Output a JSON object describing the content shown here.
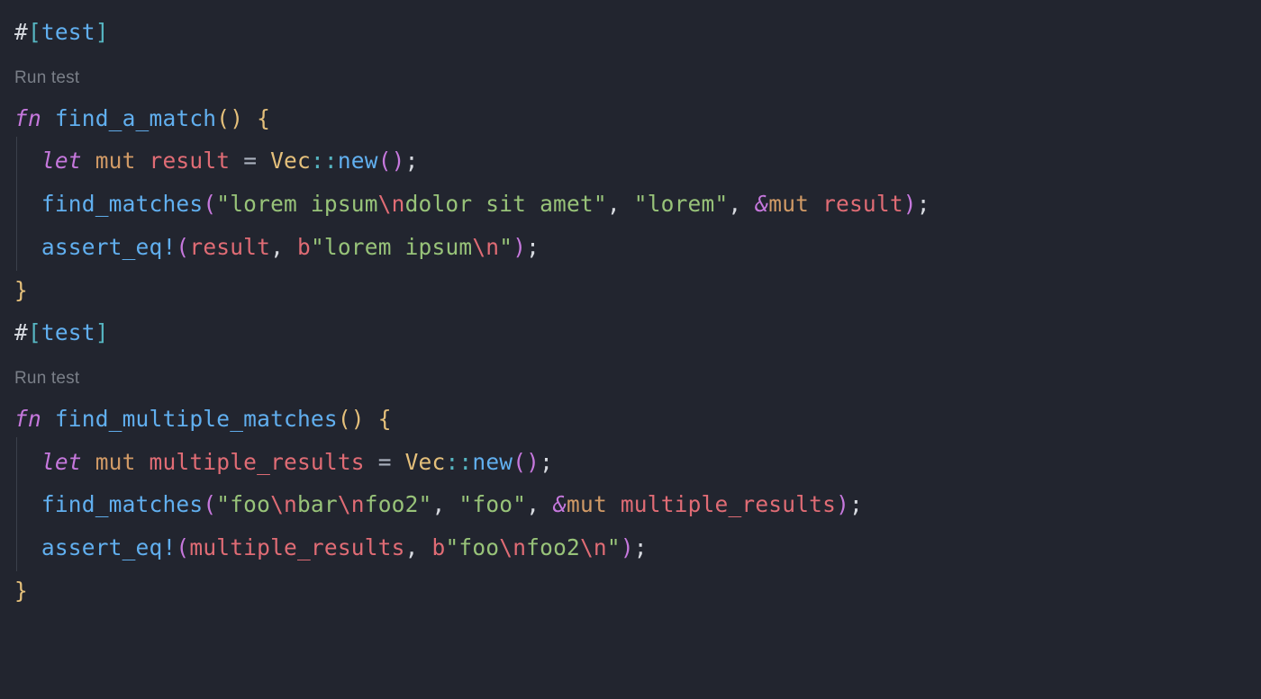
{
  "colors": {
    "bg": "#22252f",
    "fg": "#d7dae0",
    "muted": "#7a7f88",
    "keyword": "#c678dd",
    "orange": "#d19a66",
    "yellow": "#e5c07b",
    "blue": "#61afef",
    "green": "#98c379",
    "red": "#e06c75",
    "cyan": "#56b6c2"
  },
  "code": {
    "lines": [
      {
        "type": "attr",
        "tokens": [
          {
            "t": "#",
            "c": "punct"
          },
          {
            "t": "[",
            "c": "cyan"
          },
          {
            "t": "test",
            "c": "fn-call"
          },
          {
            "t": "]",
            "c": "cyan"
          }
        ]
      },
      {
        "type": "codelens",
        "text": "Run test"
      },
      {
        "type": "line",
        "indent": 0,
        "tokens": [
          {
            "t": "fn",
            "c": "kw-fn"
          },
          {
            "t": " ",
            "c": ""
          },
          {
            "t": "find_a_match",
            "c": "fn-name"
          },
          {
            "t": "()",
            "c": "by"
          },
          {
            "t": " ",
            "c": ""
          },
          {
            "t": "{",
            "c": "by"
          }
        ]
      },
      {
        "type": "line",
        "indent": 1,
        "tokens": [
          {
            "t": "let",
            "c": "kw-it"
          },
          {
            "t": " ",
            "c": ""
          },
          {
            "t": "mut",
            "c": "kw-mut"
          },
          {
            "t": " ",
            "c": ""
          },
          {
            "t": "result",
            "c": "var"
          },
          {
            "t": " ",
            "c": ""
          },
          {
            "t": "=",
            "c": "op"
          },
          {
            "t": " ",
            "c": ""
          },
          {
            "t": "Vec",
            "c": "type"
          },
          {
            "t": "::",
            "c": "cyan"
          },
          {
            "t": "new",
            "c": "fn-call"
          },
          {
            "t": "()",
            "c": "bc"
          },
          {
            "t": ";",
            "c": "punct"
          }
        ]
      },
      {
        "type": "line",
        "indent": 1,
        "tokens": [
          {
            "t": "find_matches",
            "c": "fn-call"
          },
          {
            "t": "(",
            "c": "bc"
          },
          {
            "t": "\"lorem ipsum",
            "c": "str"
          },
          {
            "t": "\\n",
            "c": "esc"
          },
          {
            "t": "dolor sit amet\"",
            "c": "str"
          },
          {
            "t": ",",
            "c": "punct"
          },
          {
            "t": " ",
            "c": ""
          },
          {
            "t": "\"lorem\"",
            "c": "str"
          },
          {
            "t": ",",
            "c": "punct"
          },
          {
            "t": " ",
            "c": ""
          },
          {
            "t": "&",
            "c": "kw-it"
          },
          {
            "t": "mut",
            "c": "kw-mut"
          },
          {
            "t": " ",
            "c": ""
          },
          {
            "t": "result",
            "c": "var"
          },
          {
            "t": ")",
            "c": "bc"
          },
          {
            "t": ";",
            "c": "punct"
          }
        ]
      },
      {
        "type": "line",
        "indent": 1,
        "tokens": [
          {
            "t": "assert_eq!",
            "c": "fn-call"
          },
          {
            "t": "(",
            "c": "bc"
          },
          {
            "t": "result",
            "c": "var"
          },
          {
            "t": ",",
            "c": "punct"
          },
          {
            "t": " ",
            "c": ""
          },
          {
            "t": "b",
            "c": "var"
          },
          {
            "t": "\"lorem ipsum",
            "c": "str"
          },
          {
            "t": "\\n",
            "c": "esc"
          },
          {
            "t": "\"",
            "c": "str"
          },
          {
            "t": ")",
            "c": "bc"
          },
          {
            "t": ";",
            "c": "punct"
          }
        ]
      },
      {
        "type": "line",
        "indent": 0,
        "tokens": [
          {
            "t": "}",
            "c": "by"
          }
        ]
      },
      {
        "type": "attr",
        "tokens": [
          {
            "t": "#",
            "c": "punct"
          },
          {
            "t": "[",
            "c": "cyan"
          },
          {
            "t": "test",
            "c": "fn-call"
          },
          {
            "t": "]",
            "c": "cyan"
          }
        ]
      },
      {
        "type": "codelens",
        "text": "Run test"
      },
      {
        "type": "line",
        "indent": 0,
        "tokens": [
          {
            "t": "fn",
            "c": "kw-fn"
          },
          {
            "t": " ",
            "c": ""
          },
          {
            "t": "find_multiple_matches",
            "c": "fn-name"
          },
          {
            "t": "()",
            "c": "by"
          },
          {
            "t": " ",
            "c": ""
          },
          {
            "t": "{",
            "c": "by"
          }
        ]
      },
      {
        "type": "line",
        "indent": 1,
        "tokens": [
          {
            "t": "let",
            "c": "kw-it"
          },
          {
            "t": " ",
            "c": ""
          },
          {
            "t": "mut",
            "c": "kw-mut"
          },
          {
            "t": " ",
            "c": ""
          },
          {
            "t": "multiple_results",
            "c": "var"
          },
          {
            "t": " ",
            "c": ""
          },
          {
            "t": "=",
            "c": "op"
          },
          {
            "t": " ",
            "c": ""
          },
          {
            "t": "Vec",
            "c": "type"
          },
          {
            "t": "::",
            "c": "cyan"
          },
          {
            "t": "new",
            "c": "fn-call"
          },
          {
            "t": "()",
            "c": "bc"
          },
          {
            "t": ";",
            "c": "punct"
          }
        ]
      },
      {
        "type": "line",
        "indent": 1,
        "tokens": [
          {
            "t": "find_matches",
            "c": "fn-call"
          },
          {
            "t": "(",
            "c": "bc"
          },
          {
            "t": "\"foo",
            "c": "str"
          },
          {
            "t": "\\n",
            "c": "esc"
          },
          {
            "t": "bar",
            "c": "str"
          },
          {
            "t": "\\n",
            "c": "esc"
          },
          {
            "t": "foo2\"",
            "c": "str"
          },
          {
            "t": ",",
            "c": "punct"
          },
          {
            "t": " ",
            "c": ""
          },
          {
            "t": "\"foo\"",
            "c": "str"
          },
          {
            "t": ",",
            "c": "punct"
          },
          {
            "t": " ",
            "c": ""
          },
          {
            "t": "&",
            "c": "kw-it"
          },
          {
            "t": "mut",
            "c": "kw-mut"
          },
          {
            "t": " ",
            "c": ""
          },
          {
            "t": "multiple_results",
            "c": "var"
          },
          {
            "t": ")",
            "c": "bc"
          },
          {
            "t": ";",
            "c": "punct"
          }
        ]
      },
      {
        "type": "line",
        "indent": 1,
        "tokens": [
          {
            "t": "assert_eq!",
            "c": "fn-call"
          },
          {
            "t": "(",
            "c": "bc"
          },
          {
            "t": "multiple_results",
            "c": "var"
          },
          {
            "t": ",",
            "c": "punct"
          },
          {
            "t": " ",
            "c": ""
          },
          {
            "t": "b",
            "c": "var"
          },
          {
            "t": "\"foo",
            "c": "str"
          },
          {
            "t": "\\n",
            "c": "esc"
          },
          {
            "t": "foo2",
            "c": "str"
          },
          {
            "t": "\\n",
            "c": "esc"
          },
          {
            "t": "\"",
            "c": "str"
          },
          {
            "t": ")",
            "c": "bc"
          },
          {
            "t": ";",
            "c": "punct"
          }
        ]
      },
      {
        "type": "line",
        "indent": 0,
        "tokens": [
          {
            "t": "}",
            "c": "by"
          }
        ]
      }
    ]
  }
}
